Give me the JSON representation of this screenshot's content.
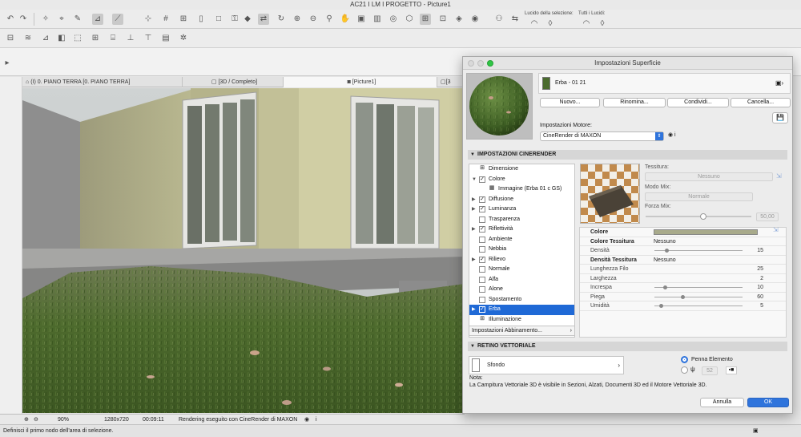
{
  "window": {
    "title": "AC21 I LM I PROGETTO - Picture1"
  },
  "toolbar": {
    "selection_lucido_label": "Lucido della selezione:",
    "all_lucidi_label": "Tutti i Lucidi:"
  },
  "tabs": [
    {
      "label": "(I) 0. PIANO TERRA [0. PIANO TERRA]",
      "icon": "floor-plan-icon"
    },
    {
      "label": "[3D / Completo]",
      "icon": "3d-icon"
    },
    {
      "label": "[Picture1]",
      "icon": "camera-icon"
    },
    {
      "label": "[3",
      "icon": "3d-icon"
    }
  ],
  "status": {
    "zoom": "90%",
    "resolution": "1280x720",
    "time": "00:09:11",
    "message": "Rendering eseguito con CineRender di MAXON"
  },
  "hint": "Definisci il primo nodo dell'area di selezione.",
  "dialog": {
    "title": "Impostazioni Superficie",
    "surface_name": "Erba - 01 21",
    "surface_color": "#4a6b2e",
    "buttons": {
      "new": "Nuovo...",
      "rename": "Rinomina...",
      "share": "Condividi...",
      "delete": "Cancella..."
    },
    "engine_label": "Impostazioni Motore:",
    "engine_value": "CineRender di MAXON",
    "cinerender_header": "IMPOSTAZIONI CINERENDER",
    "tree": [
      {
        "label": "Dimensione",
        "arrow": "",
        "check": "icon"
      },
      {
        "label": "Colore",
        "arrow": "▼",
        "check": "on"
      },
      {
        "label": "Immagine (Erba 01 c GS)",
        "arrow": "",
        "check": "img"
      },
      {
        "label": "Diffusione",
        "arrow": "▶",
        "check": "on"
      },
      {
        "label": "Luminanza",
        "arrow": "▶",
        "check": "on"
      },
      {
        "label": "Trasparenza",
        "arrow": "",
        "check": "off"
      },
      {
        "label": "Riflettività",
        "arrow": "▶",
        "check": "on"
      },
      {
        "label": "Ambiente",
        "arrow": "",
        "check": "off"
      },
      {
        "label": "Nebbia",
        "arrow": "",
        "check": "off"
      },
      {
        "label": "Rilievo",
        "arrow": "▶",
        "check": "on"
      },
      {
        "label": "Normale",
        "arrow": "",
        "check": "off"
      },
      {
        "label": "Alfa",
        "arrow": "",
        "check": "off"
      },
      {
        "label": "Alone",
        "arrow": "",
        "check": "off"
      },
      {
        "label": "Spostamento",
        "arrow": "",
        "check": "off"
      },
      {
        "label": "Erba",
        "arrow": "▶",
        "check": "on",
        "selected": true
      },
      {
        "label": "Illuminazione",
        "arrow": "",
        "check": "icon"
      }
    ],
    "match_settings": "Impostazioni Abbinamento...",
    "texture_label": "Tessitura:",
    "texture_value": "Nessuno",
    "mix_mode_label": "Modo Mix:",
    "mix_mode_value": "Normale",
    "mix_strength_label": "Forza Mix:",
    "mix_strength_value": "50,00",
    "mix_strength_fraction": 0.55,
    "props": [
      {
        "key": "Colore",
        "bold": true,
        "swatch": "#a8aa8b"
      },
      {
        "key": "Colore Tessitura",
        "bold": true,
        "value": "Nessuno"
      },
      {
        "key": "Densità",
        "num": "15",
        "slider": 0.12
      },
      {
        "key": "Densità Tessitura",
        "bold": true,
        "value": "Nessuno"
      },
      {
        "key": "Lunghezza Filo",
        "num": "25"
      },
      {
        "key": "Larghezza",
        "num": "2"
      },
      {
        "key": "Increspa",
        "num": "10",
        "slider": 0.1
      },
      {
        "key": "Piega",
        "num": "60",
        "slider": 0.3
      },
      {
        "key": "Umidità",
        "num": "5",
        "slider": 0.05
      }
    ],
    "vector_header": "RETINO VETTORIALE",
    "background_label": "Sfondo",
    "pen_label": "Penna Elemento",
    "pen_number": "52",
    "note_title": "Nota:",
    "note_text": "La Campitura Vettoriale 3D è visibile in Sezioni, Alzati, Documenti 3D ed il Motore Vettoriale 3D.",
    "cancel": "Annulla",
    "ok": "OK"
  }
}
